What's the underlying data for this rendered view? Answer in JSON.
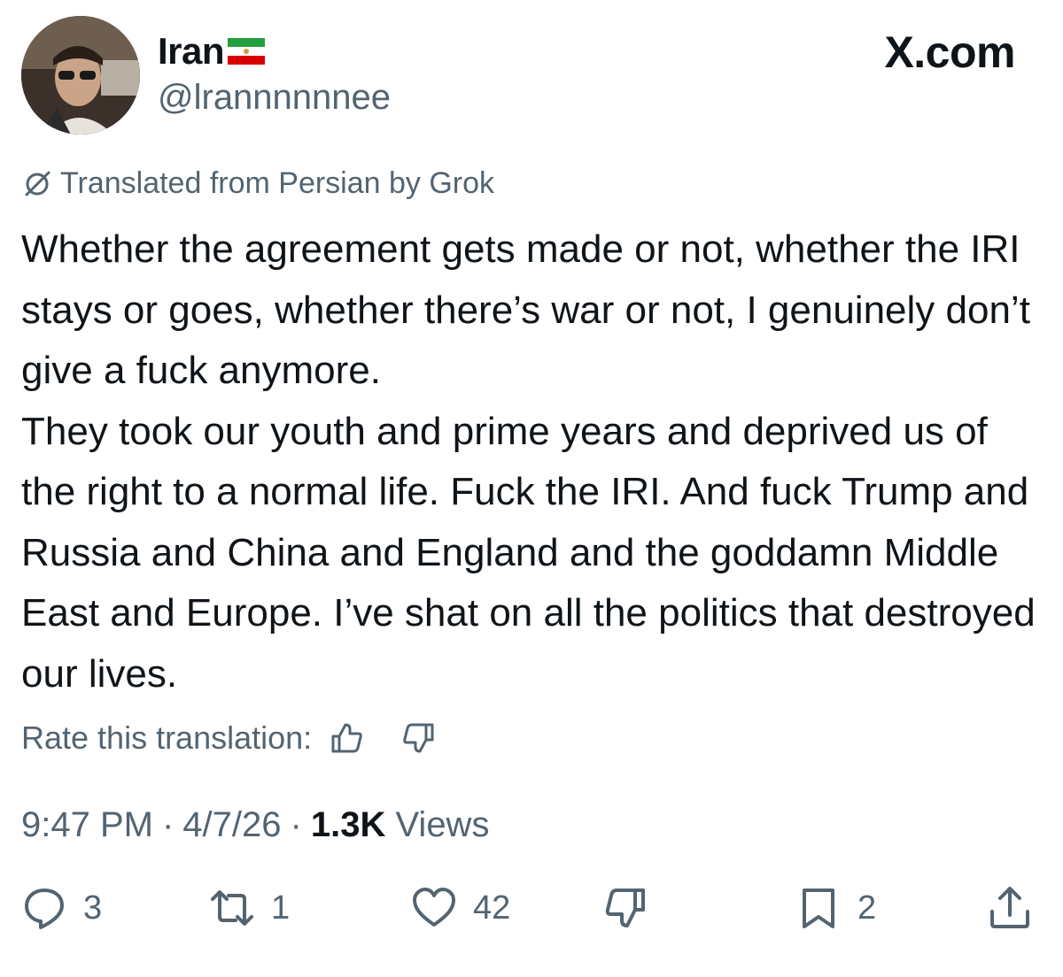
{
  "author": {
    "display_name": "Iran",
    "handle": "@lrannnnnnee"
  },
  "brand": "X.com",
  "translation_note": "Translated from Persian by Grok",
  "tweet": {
    "paragraphs": [
      "Whether the agreement gets made or not, whether the IRI stays or goes, whether there’s war or not, I genuinely don’t give a fuck anymore.",
      "They took our youth and prime years and deprived us of the right to a normal life. Fuck the IRI. And fuck Trump and Russia and China and England and the goddamn Middle East and Europe. I’ve shat on all the politics that destroyed our lives."
    ]
  },
  "rate_translation_label": "Rate this translation:",
  "meta": {
    "time": "9:47 PM",
    "sep1": "·",
    "date": "4/7/26",
    "sep2": "·",
    "views_count": "1.3K",
    "views_label": "Views"
  },
  "actions": {
    "reply_count": "3",
    "repost_count": "1",
    "like_count": "42",
    "bookmark_count": "2"
  },
  "icons": {
    "flag": "iran-lion-and-sun-flag-icon",
    "translate": "grok-icon",
    "thumbs_up": "thumbs-up-icon",
    "thumbs_down": "thumbs-down-icon",
    "reply": "reply-bubble-icon",
    "repost": "repost-icon",
    "like": "heart-icon",
    "dislike": "thumbs-down-icon",
    "bookmark": "bookmark-icon",
    "share": "share-icon"
  },
  "colors": {
    "text": "#0f1419",
    "secondary": "#536471",
    "flag_green": "#239f40",
    "flag_red": "#da0000"
  }
}
